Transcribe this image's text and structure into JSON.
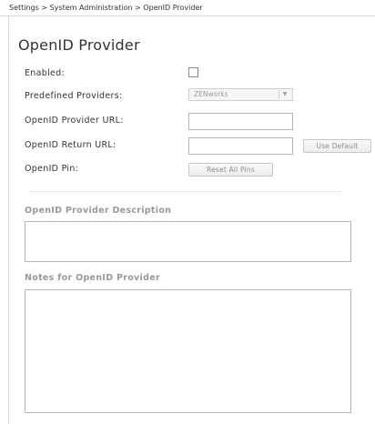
{
  "breadcrumb": "Settings > System Administration > OpenID Provider",
  "page_title": "OpenID Provider",
  "fields": {
    "enabled_label": "Enabled:",
    "enabled_checked": false,
    "predefined_label": "Predefined Providers:",
    "predefined_selected": "ZENworks",
    "provider_url_label": "OpenID Provider URL:",
    "provider_url_value": "",
    "return_url_label": "OpenID Return URL:",
    "return_url_value": "",
    "pin_label": "OpenID Pin:"
  },
  "buttons": {
    "use_default": "Use Default",
    "reset_all_pins": "Reset All Pins"
  },
  "sections": {
    "description_label": "OpenID Provider Description",
    "description_value": "",
    "notes_label": "Notes for OpenID Provider",
    "notes_value": ""
  },
  "icons": {
    "select_arrow": "chevron-down-icon"
  },
  "colors": {
    "border": "#d6d6d6",
    "section_label": "#9a9a9a",
    "button_text": "#8c8c8c"
  }
}
